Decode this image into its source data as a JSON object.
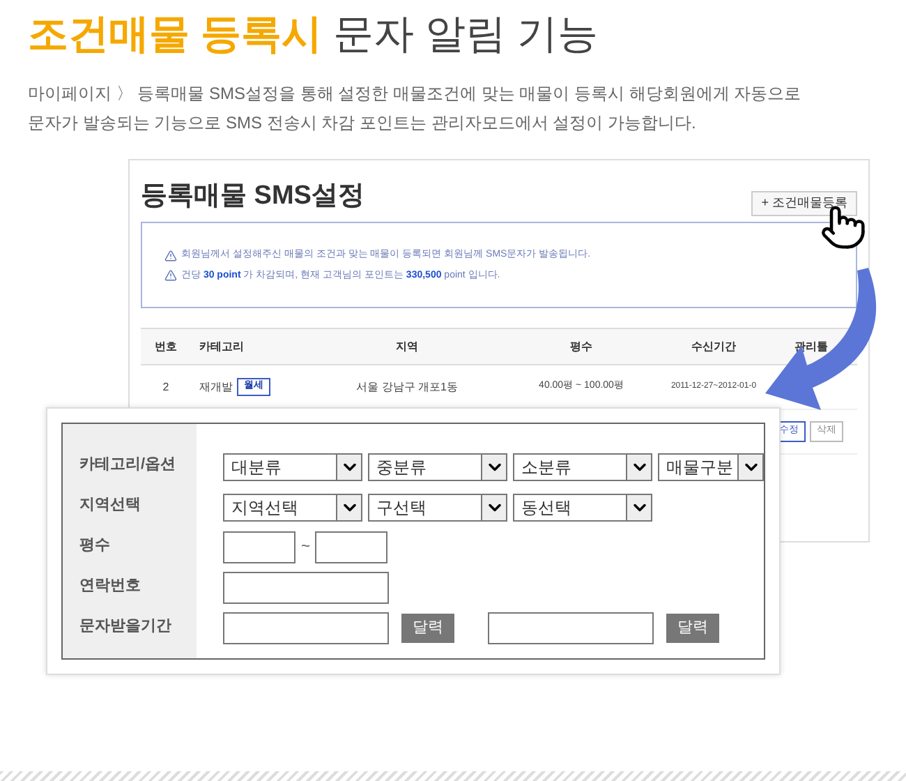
{
  "header": {
    "title_highlight": "조건매물 등록시",
    "title_rest": "문자 알림 기능",
    "description": [
      "마이페이지 〉 등록매물 SMS설정을 통해 설정한 매물조건에 맞는 매물이 등록시 해당회원에게 자동으로",
      "문자가 발송되는 기능으로 SMS 전송시 차감 포인트는 관리자모드에서 설정이 가능합니다."
    ]
  },
  "panel": {
    "title": "등록매물 SMS설정",
    "add_button": "+ 조건매물등록",
    "notices": [
      "회원님께서 설정해주신 매물의 조건과 맞는 매물이 등록되면 회원님께 SMS문자가 발송됩니다.",
      "건당 **30 point** 가 차감되며, 현재 고객님의 포인트는 **330,500** point 입니다."
    ],
    "table": {
      "columns": [
        "번호",
        "카테고리",
        "지역",
        "평수",
        "수신기간",
        "관리툴"
      ],
      "rows": [
        {
          "number": "2",
          "category": "재개발",
          "badge": "월세",
          "region": "서울 강남구 개포1동",
          "size": "40.00평 ~ 100.00평",
          "period": "2011-12-27~2012-01-0",
          "actions": []
        },
        {
          "actions": [
            "수정",
            "삭제"
          ]
        }
      ]
    }
  },
  "form": {
    "rows": [
      {
        "label": "카테고리/옵션",
        "controls": [
          {
            "kind": "select",
            "value": "대분류"
          },
          {
            "kind": "select",
            "value": "중분류"
          },
          {
            "kind": "select",
            "value": "소분류"
          },
          {
            "kind": "narrow_select",
            "value": "매물구분"
          }
        ]
      },
      {
        "label": "지역선택",
        "controls": [
          {
            "kind": "select",
            "value": "지역선택"
          },
          {
            "kind": "select",
            "value": "구선택"
          },
          {
            "kind": "select",
            "value": "동선택"
          }
        ]
      },
      {
        "label": "평수",
        "controls": [
          {
            "kind": "short_input"
          },
          {
            "kind": "separator",
            "text": "~"
          },
          {
            "kind": "short_input"
          }
        ]
      },
      {
        "label": "연락번호",
        "controls": [
          {
            "kind": "input"
          }
        ]
      },
      {
        "label": "문자받을기간",
        "controls": [
          {
            "kind": "input"
          },
          {
            "kind": "button",
            "label": "달력"
          },
          {
            "kind": "gap"
          },
          {
            "kind": "input"
          },
          {
            "kind": "button",
            "label": "달력"
          }
        ]
      }
    ]
  }
}
